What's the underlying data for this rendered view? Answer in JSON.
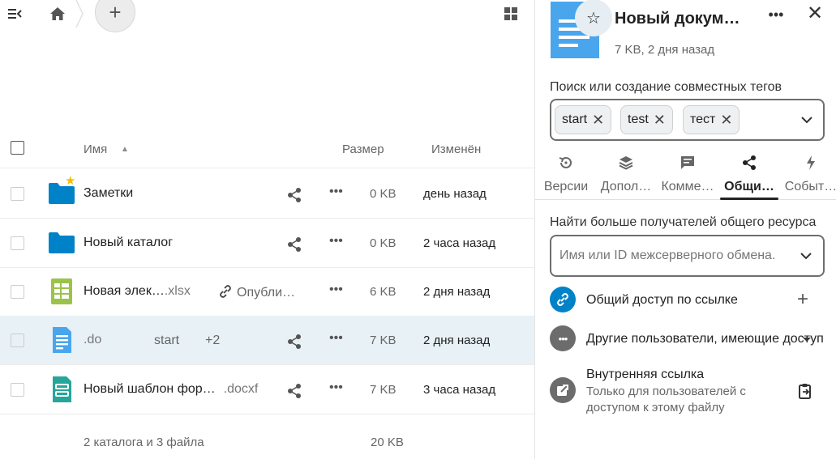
{
  "toolbar": {
    "menu_icon": "menu-collapse-icon",
    "home_icon": "home-icon",
    "new_label": "+",
    "view_icon": "grid-view-icon"
  },
  "list_header": {
    "name": "Имя",
    "size": "Размер",
    "modified": "Изменён",
    "sort_indicator": "▲"
  },
  "files": [
    {
      "name": "Заметки",
      "ext": "",
      "icon": "folder-icon",
      "favorite": true,
      "size": "0 KB",
      "modified": "день назад",
      "shared_label": "",
      "tag_text": "",
      "tag_more": "",
      "share_icon": true,
      "selected": false
    },
    {
      "name": "Новый каталог",
      "ext": "",
      "icon": "folder-icon",
      "favorite": false,
      "size": "0 KB",
      "modified": "2 часа назад",
      "shared_label": "",
      "tag_text": "",
      "tag_more": "",
      "share_icon": true,
      "selected": false
    },
    {
      "name": "Новая элек…",
      "ext": ".xlsx",
      "icon": "spreadsheet-icon",
      "favorite": false,
      "size": "6 KB",
      "modified": "2 дня назад",
      "shared_label": "Опубли…",
      "tag_text": "",
      "tag_more": "",
      "share_icon": false,
      "selected": false
    },
    {
      "name": "",
      "ext": ".do",
      "icon": "document-icon",
      "favorite": false,
      "size": "7 KB",
      "modified": "2 дня назад",
      "shared_label": "",
      "tag_text": "start",
      "tag_more": "+2",
      "share_icon": true,
      "selected": true
    },
    {
      "name": "Новый шаблон фор…",
      "ext": ".docxf",
      "icon": "form-template-icon",
      "favorite": false,
      "size": "7 KB",
      "modified": "3 часа назад",
      "shared_label": "",
      "tag_text": "",
      "tag_more": "",
      "share_icon": true,
      "selected": false
    }
  ],
  "summary": {
    "count": "2 каталога и 3 файла",
    "total_size": "20 KB"
  },
  "sidebar": {
    "title": "Новый докум…",
    "meta": "7 KB, 2 дня назад",
    "fav_icon": "star-outline-icon",
    "more_label": "•••",
    "close_label": "✕",
    "tags_label": "Поиск или создание совместных тегов",
    "tags": [
      "start",
      "test",
      "тест"
    ],
    "tabs": [
      {
        "label": "Версии",
        "icon": "history-icon",
        "active": false
      },
      {
        "label": "Допол…",
        "icon": "layers-icon",
        "active": false
      },
      {
        "label": "Комме…",
        "icon": "comment-icon",
        "active": false
      },
      {
        "label": "Общи…",
        "icon": "share-icon",
        "active": true
      },
      {
        "label": "Событ…",
        "icon": "activity-icon",
        "active": false
      }
    ],
    "sharing": {
      "find_label": "Найти больше получателей общего ресурса",
      "input_placeholder": "Имя или ID межсерверного обмена.",
      "link_share_title": "Общий доступ по ссылке",
      "add_label": "+",
      "others_title": "Другие пользователи, имеющие доступ",
      "internal_title": "Внутренняя ссылка",
      "internal_sub_1": "Только для пользователей с",
      "internal_sub_2": "доступом к этому файлу"
    }
  },
  "colors": {
    "accent": "#0082c9",
    "folder": "#0082c9",
    "spreadsheet": "#9bc34a",
    "document": "#49a6ed",
    "form": "#26a69a",
    "selected_row": "#e8f1f6",
    "star": "#f0c000"
  }
}
